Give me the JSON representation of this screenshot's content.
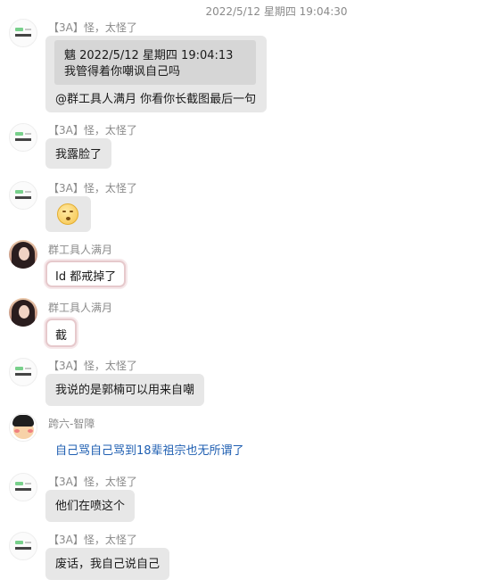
{
  "timestamp": "2022/5/12 星期四 19:04:30",
  "messages": [
    {
      "sender": "【3A】怪，太怪了",
      "quote_header": "魑  2022/5/12 星期四 19:04:13",
      "quote_text": "我管得着你嘲讽自己吗",
      "text": "@群工具人满月 你看你长截图最后一句"
    },
    {
      "sender": "【3A】怪，太怪了",
      "text": "我露脸了"
    },
    {
      "sender": "【3A】怪，太怪了",
      "text": ""
    },
    {
      "sender": "群工具人满月",
      "text": "Id 都戒掉了"
    },
    {
      "sender": "群工具人满月",
      "text": "截"
    },
    {
      "sender": "【3A】怪，太怪了",
      "text": "我说的是郭楠可以用来自嘲"
    },
    {
      "sender": "跨六-智障",
      "text": "自己骂自己骂到18辈祖宗也无所谓了"
    },
    {
      "sender": "【3A】怪，太怪了",
      "text": "他们在喷这个"
    },
    {
      "sender": "【3A】怪，太怪了",
      "text": "废话，我自己说自己"
    }
  ],
  "colors": {
    "bubble": "#e7e7e7",
    "sender": "#8a8a8a",
    "link_text": "#1f5fb2"
  },
  "icons": {
    "emoji": "face-emoji"
  }
}
